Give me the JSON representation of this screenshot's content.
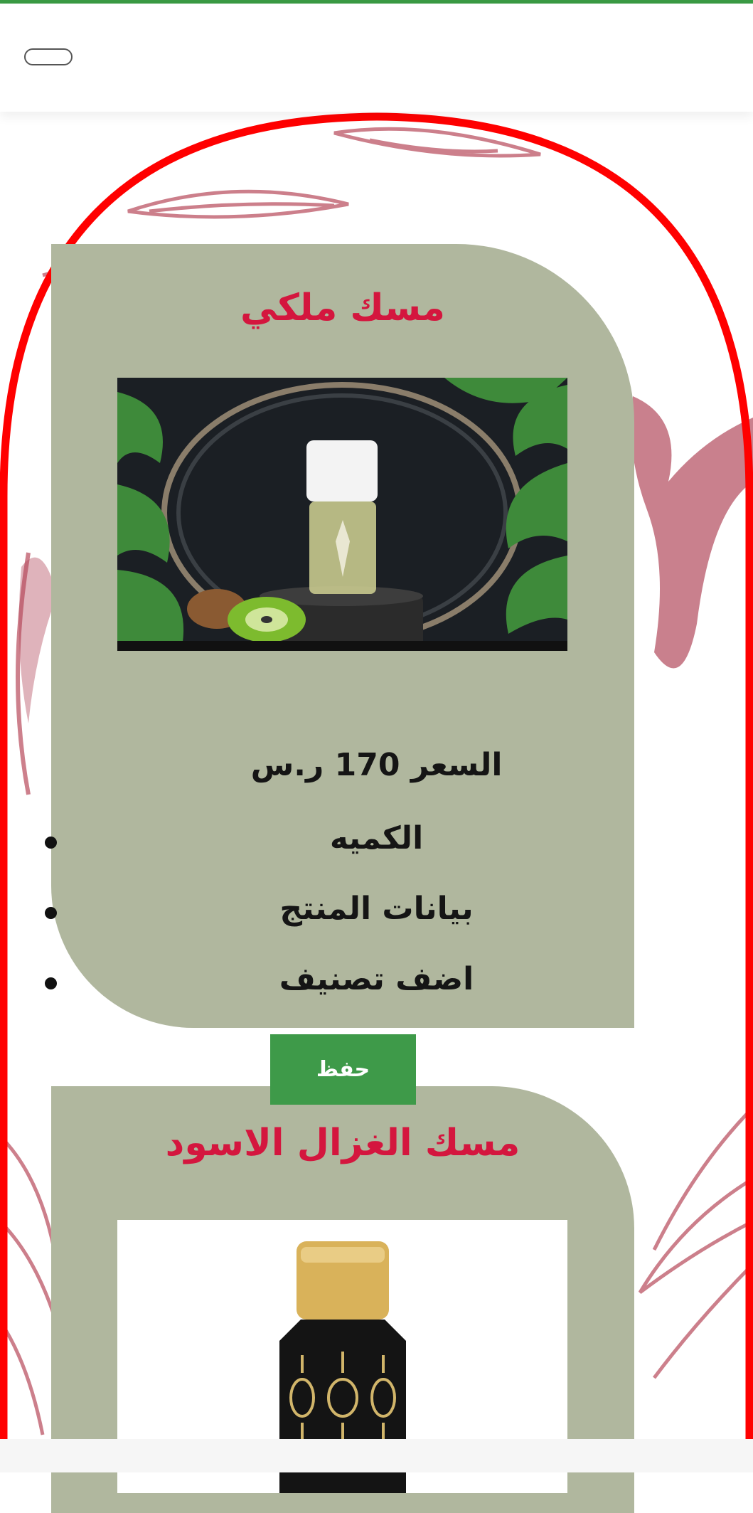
{
  "header": {
    "menu_button_icon": "menu-toggle-icon"
  },
  "products": [
    {
      "title": "مسك ملكي",
      "image_icon": "perfume-bottle-kiwi-image",
      "price_label": "السعر 170 ر.س",
      "menu": [
        "الكميه",
        "بيانات المنتج",
        "اضف تصنيف"
      ]
    },
    {
      "title": "مسك الغزال الاسود",
      "image_icon": "black-perfume-bottle-image"
    }
  ],
  "save_button": {
    "label": "حفظ"
  },
  "colors": {
    "accent_green": "#3e9a49",
    "card_bg": "#b0b79e",
    "title_red": "#d4163e",
    "arch_red": "#ff0000"
  }
}
